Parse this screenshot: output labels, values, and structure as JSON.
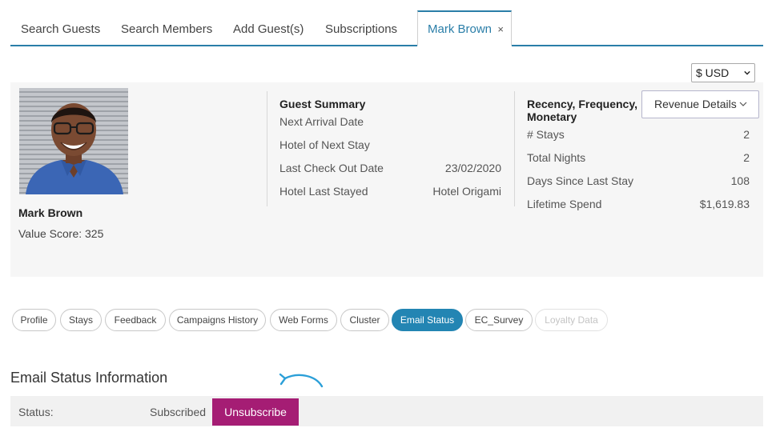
{
  "tabs": [
    {
      "label": "Search Guests"
    },
    {
      "label": "Search Members"
    },
    {
      "label": "Add Guest(s)"
    },
    {
      "label": "Subscriptions"
    },
    {
      "label": "Mark Brown",
      "active": true,
      "close": "×"
    }
  ],
  "currency": {
    "selected": "$ USD"
  },
  "guest": {
    "name": "Mark Brown",
    "value_score": "Value Score: 325"
  },
  "guest_summary": {
    "title": "Guest Summary",
    "rows": [
      {
        "label": "Next Arrival Date",
        "value": ""
      },
      {
        "label": "Hotel of Next Stay",
        "value": ""
      },
      {
        "label": "Last Check Out Date",
        "value": "23/02/2020"
      },
      {
        "label": "Hotel Last Stayed",
        "value": "Hotel Origami"
      }
    ]
  },
  "rfm": {
    "title": "Recency, Frequency, Monetary",
    "revenue_button": "Revenue Details",
    "rows": [
      {
        "label": "# Stays",
        "value": "2"
      },
      {
        "label": "Total Nights",
        "value": "2"
      },
      {
        "label": "Days Since Last Stay",
        "value": "108"
      },
      {
        "label": "Lifetime Spend",
        "value": "$1,619.83"
      }
    ]
  },
  "pills": [
    {
      "label": "Profile"
    },
    {
      "label": "Stays"
    },
    {
      "label": "Feedback"
    },
    {
      "label": "Campaigns History"
    },
    {
      "label": "Web Forms"
    },
    {
      "label": "Cluster"
    },
    {
      "label": "Email Status",
      "active": true
    },
    {
      "label": "EC_Survey"
    },
    {
      "label": "Loyalty Data",
      "disabled": true
    }
  ],
  "email_status": {
    "title": "Email Status Information",
    "status_label": "Status:",
    "status_value": "Subscribed",
    "unsubscribe_label": "Unsubscribe"
  },
  "colors": {
    "accent": "#2a7ea8",
    "pill_active": "#2385b3",
    "unsubscribe": "#a51d74",
    "arrow": "#2b9fd8"
  },
  "icons": {
    "tab_close": "close-icon",
    "currency": "chevron-down-icon",
    "revenue": "chevron-down-icon",
    "hint_arrow": "curved-arrow-icon"
  }
}
